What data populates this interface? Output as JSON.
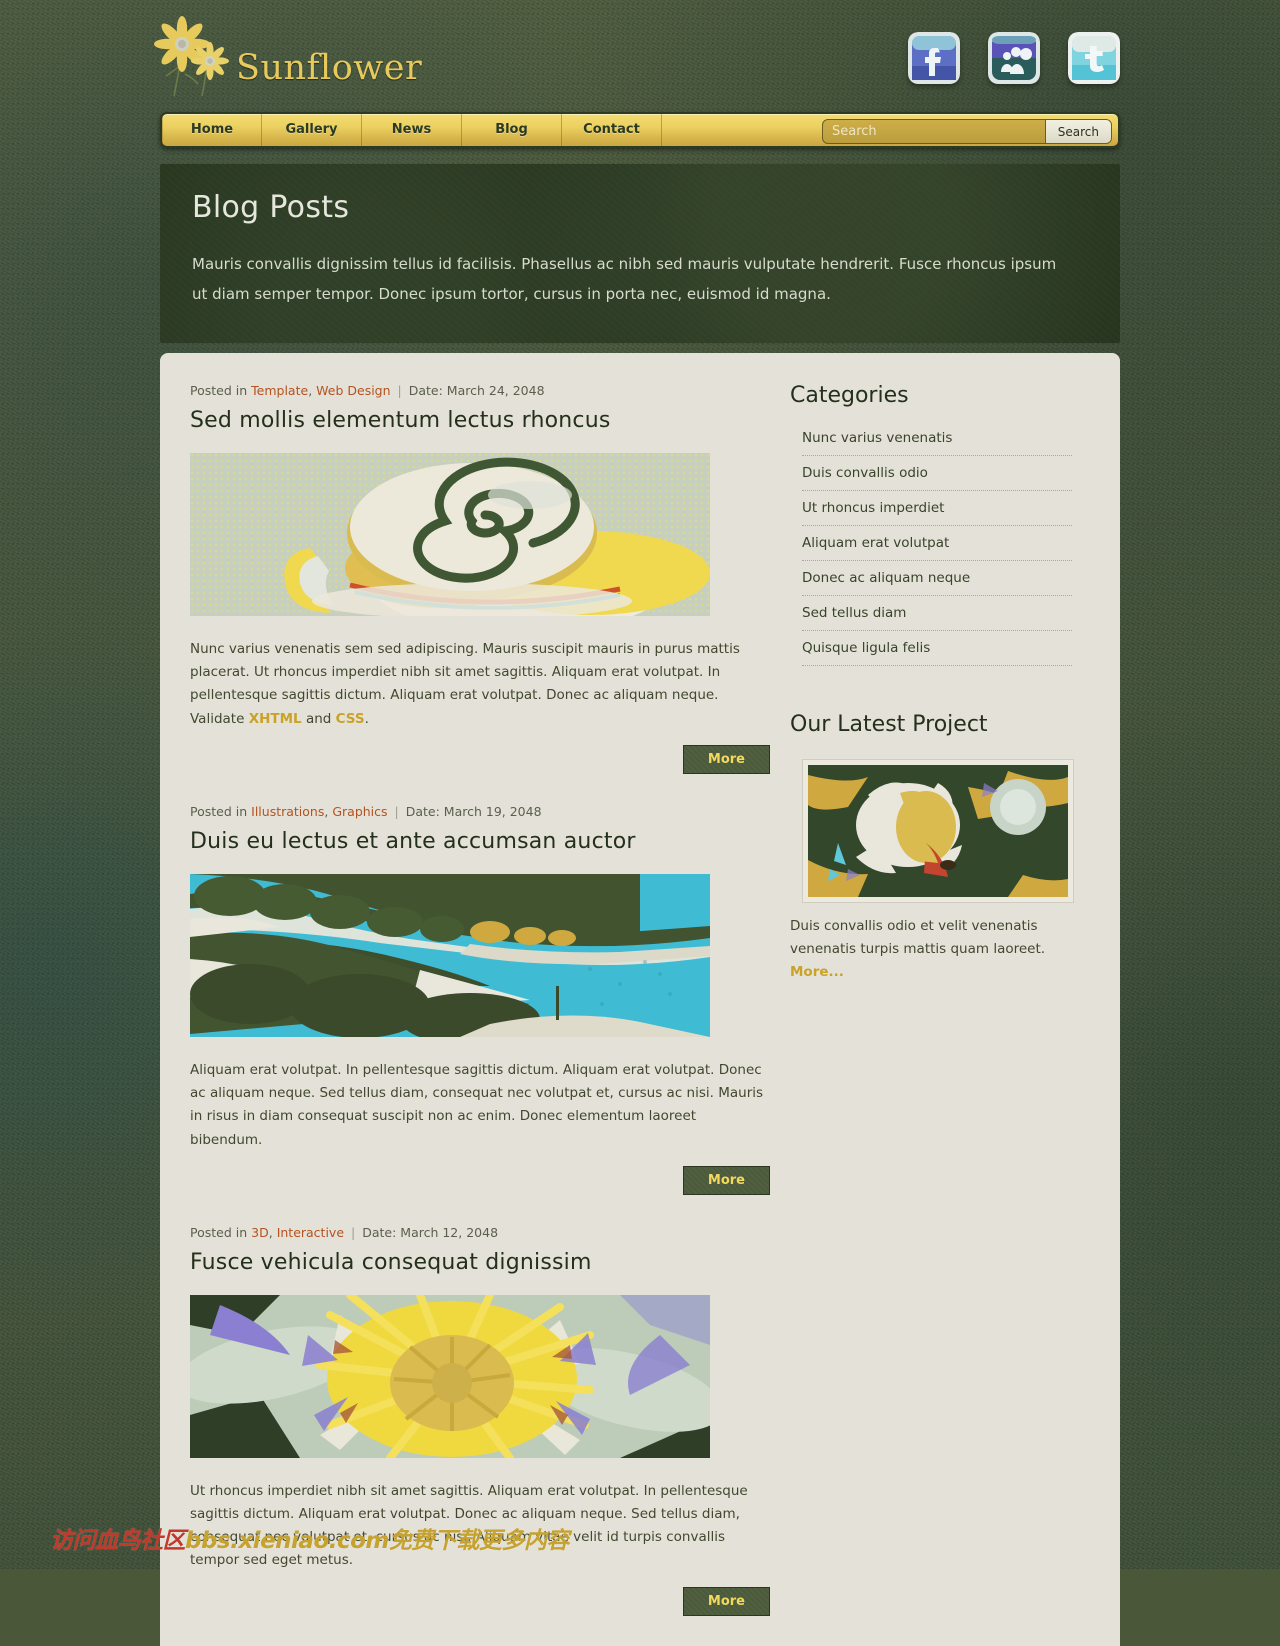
{
  "site": {
    "logo_text": "Sunflower",
    "logo_icon": "sunflower-icon"
  },
  "nav": {
    "items": [
      {
        "label": "Home",
        "name": "nav-item-home"
      },
      {
        "label": "Gallery",
        "name": "nav-item-gallery"
      },
      {
        "label": "News",
        "name": "nav-item-news"
      },
      {
        "label": "Blog",
        "name": "nav-item-blog"
      },
      {
        "label": "Contact",
        "name": "nav-item-contact"
      }
    ]
  },
  "search": {
    "placeholder": "Search",
    "button_label": "Search"
  },
  "social": [
    {
      "name": "facebook-icon",
      "label": "Facebook"
    },
    {
      "name": "myspace-icon",
      "label": "MySpace"
    },
    {
      "name": "twitter-icon",
      "label": "Twitter"
    }
  ],
  "banner": {
    "title": "Blog Posts",
    "text": "Mauris convallis dignissim tellus id facilisis. Phasellus ac nibh sed mauris vulputate hendrerit. Fusce rhoncus ipsum ut diam semper tempor. Donec ipsum tortor, cursus in porta nec, euismod id magna."
  },
  "posts": [
    {
      "posted_in_label": "Posted in",
      "categories": [
        "Template",
        "Web Design"
      ],
      "date": "Date: March 24, 2048",
      "title": "Sed mollis elementum lectus rhoncus",
      "image": "coffee-cup-latte-art-image",
      "body_before": "Nunc varius venenatis sem sed adipiscing. Mauris suscipit mauris in purus mattis placerat. Ut rhoncus imperdiet nibh sit amet sagittis. Aliquam erat volutpat. In pellentesque sagittis dictum. Aliquam erat volutpat. Donec ac aliquam neque. Validate ",
      "link1": "XHTML",
      "body_mid": " and ",
      "link2": "CSS",
      "body_after": ".",
      "more_label": "More"
    },
    {
      "posted_in_label": "Posted in",
      "categories": [
        "Illustrations",
        "Graphics"
      ],
      "date": "Date: March 19, 2048",
      "title": "Duis eu lectus et ante accumsan auctor",
      "image": "coastal-landscape-image",
      "body": "Aliquam erat volutpat. In pellentesque sagittis dictum. Aliquam erat volutpat. Donec ac aliquam neque. Sed tellus diam, consequat nec volutpat et, cursus ac nisi. Mauris in risus in diam consequat suscipit non ac enim. Donec elementum laoreet bibendum.",
      "more_label": "More"
    },
    {
      "posted_in_label": "Posted in",
      "categories": [
        "3D",
        "Interactive"
      ],
      "date": "Date: March 12, 2048",
      "title": "Fusce vehicula consequat dignissim",
      "image": "water-lily-flower-image",
      "body": "Ut rhoncus imperdiet nibh sit amet sagittis. Aliquam erat volutpat. In pellentesque sagittis dictum. Aliquam erat volutpat. Donec ac aliquam neque. Sed tellus diam, consequat nec volutpat et, cursus ac nisi. Aliquam vitae velit id turpis convallis tempor sed eget metus.",
      "more_label": "More"
    }
  ],
  "sidebar": {
    "categories_title": "Categories",
    "categories": [
      "Nunc varius venenatis",
      "Duis convallis odio",
      "Ut rhoncus imperdiet",
      "Aliquam erat volutpat",
      "Donec ac aliquam neque",
      "Sed tellus diam",
      "Quisque ligula felis"
    ],
    "project_title": "Our Latest Project",
    "project_image": "white-flower-image",
    "project_text": "Duis convallis odio et velit venenatis venenatis turpis mattis quam laoreet. ",
    "project_more": "More..."
  },
  "watermark": {
    "red_text": "访问血鸟社区",
    "gold_text": "bbs.xieniao.com免费下载更多内容"
  },
  "colors": {
    "accent_gold": "#e8c95b",
    "page_green": "#4a5b3b",
    "banner_dark": "#27351f",
    "content_cream": "#e4e2d8",
    "category_link": "#b5521f",
    "inline_link": "#c9a227"
  }
}
